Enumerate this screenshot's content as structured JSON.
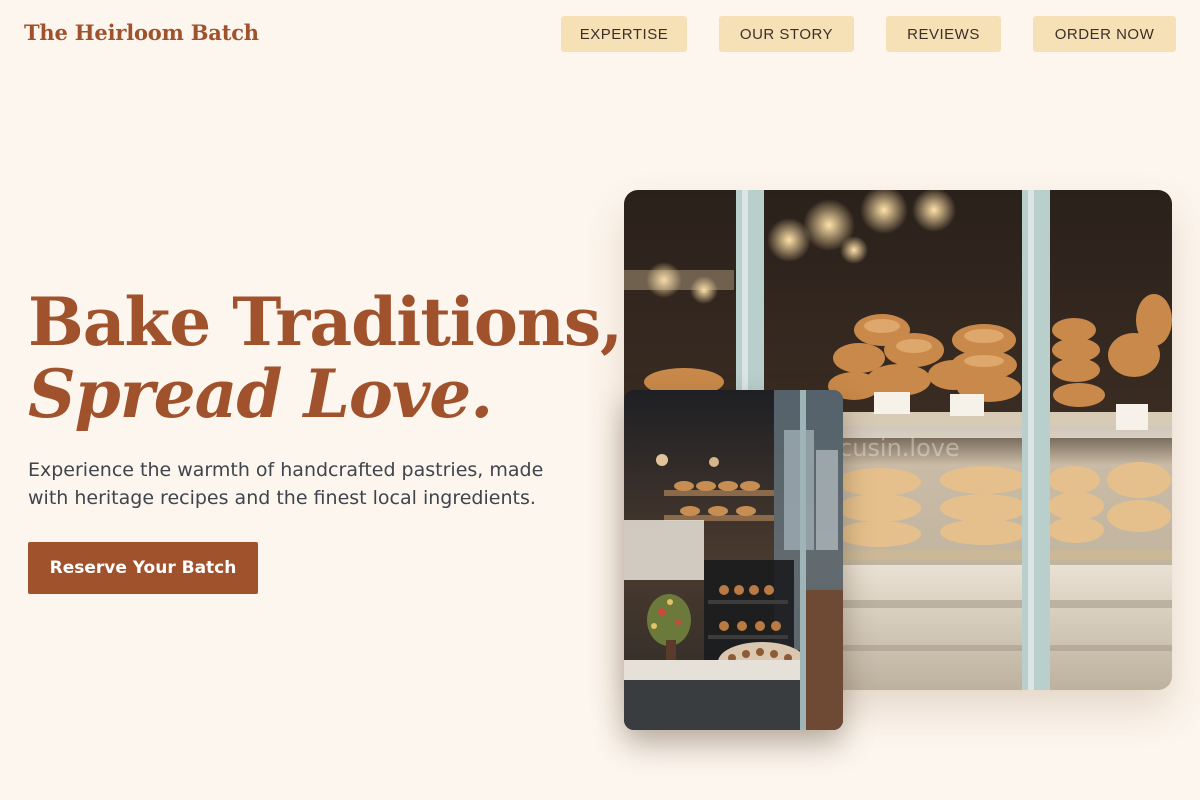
{
  "header": {
    "brand": "The Heirloom Batch",
    "nav": [
      "EXPERTISE",
      "OUR STORY",
      "REVIEWS",
      "ORDER NOW"
    ]
  },
  "hero": {
    "title_line1": "Bake Traditions,",
    "title_line2": "Spread Love.",
    "subtitle": "Experience the warmth of handcrafted pastries, made with heritage recipes and the finest local ingredients.",
    "cta_label": "Reserve Your Batch"
  },
  "images": {
    "main_watermark": "cusin.love"
  },
  "colors": {
    "brand": "#a0522d",
    "background": "#fdf6ee",
    "nav_button": "#f6e1b7",
    "body_text": "#40444c"
  }
}
